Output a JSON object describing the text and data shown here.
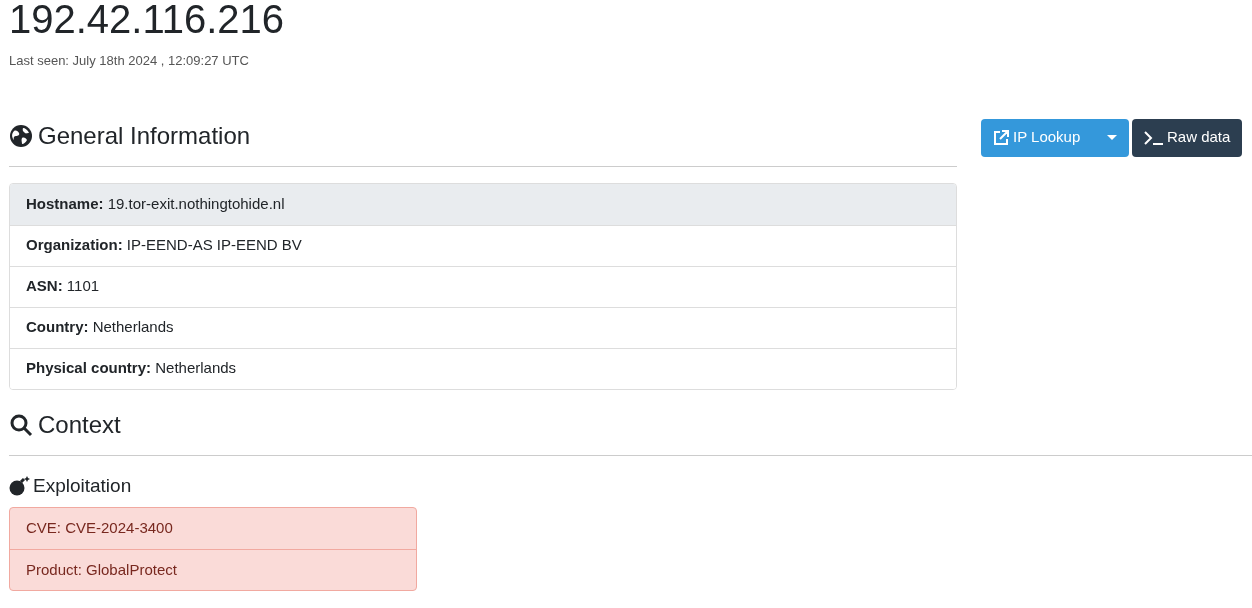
{
  "ip": "192.42.116.216",
  "last_seen": "Last seen: July 18th 2024 , 12:09:27 UTC",
  "general": {
    "title": "General Information",
    "rows": [
      {
        "label": "Hostname:",
        "value": "19.tor-exit.nothingtohide.nl",
        "selected": true
      },
      {
        "label": "Organization:",
        "value": "IP-EEND-AS IP-EEND BV",
        "selected": false
      },
      {
        "label": "ASN:",
        "value": "1101",
        "selected": false
      },
      {
        "label": "Country:",
        "value": "Netherlands",
        "selected": false
      },
      {
        "label": "Physical country:",
        "value": "Netherlands",
        "selected": false
      }
    ]
  },
  "actions": {
    "lookup": "IP Lookup",
    "raw": "Raw data"
  },
  "context": {
    "title": "Context",
    "exploitation": {
      "title": "Exploitation",
      "rows": [
        "CVE: CVE-2024-3400",
        "Product: GlobalProtect"
      ]
    }
  }
}
